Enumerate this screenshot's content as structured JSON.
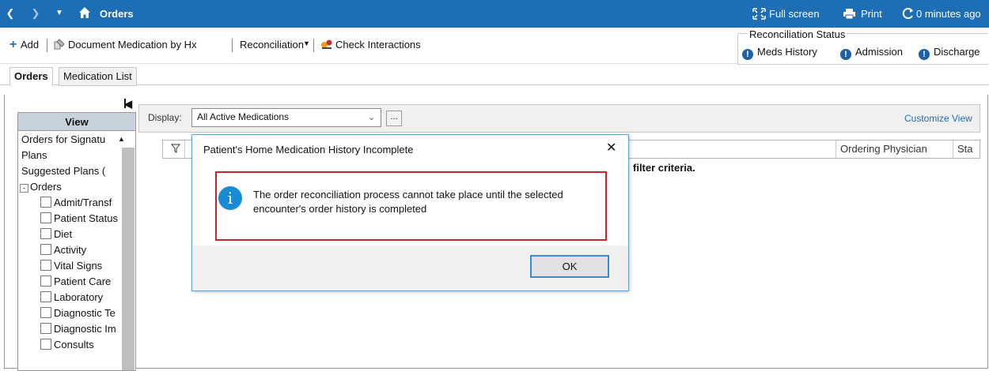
{
  "titlebar": {
    "title": "Orders",
    "fullscreen_label": "Full screen",
    "print_label": "Print",
    "refresh_label": "0 minutes ago",
    "background": "#1d6eb5"
  },
  "toolbar": {
    "add_label": "Add",
    "document_label": "Document Medication by Hx",
    "reconciliation_label": "Reconciliation",
    "check_interactions_label": "Check Interactions"
  },
  "reconciliation_status": {
    "title": "Reconciliation Status",
    "items": [
      "Meds History",
      "Admission",
      "Discharge"
    ]
  },
  "tabs": [
    {
      "label": "Orders",
      "active": true
    },
    {
      "label": "Medication List",
      "active": false
    }
  ],
  "left_panel": {
    "header": "View",
    "items": [
      "Orders for Signatu",
      "Plans",
      "Suggested Plans (",
      "Orders",
      "Admit/Transf",
      "Patient Status",
      "Diet",
      "Activity",
      "Vital Signs",
      "Patient Care",
      "Laboratory",
      "Diagnostic Te",
      "Diagnostic Im",
      "Consults"
    ]
  },
  "display": {
    "label": "Display:",
    "value": "All Active Medications",
    "more_button": "...",
    "customize_view": "Customize View"
  },
  "grid": {
    "columns": [
      "Ordering Physician",
      "Sta"
    ],
    "message": "filter criteria."
  },
  "dialog": {
    "title": "Patient's Home Medication History Incomplete",
    "message_line1": "The order reconciliation process cannot take place until the selected",
    "message_line2": "encounter's order history is completed",
    "ok_label": "OK",
    "close_glyph": "✕",
    "info_glyph": "i"
  }
}
